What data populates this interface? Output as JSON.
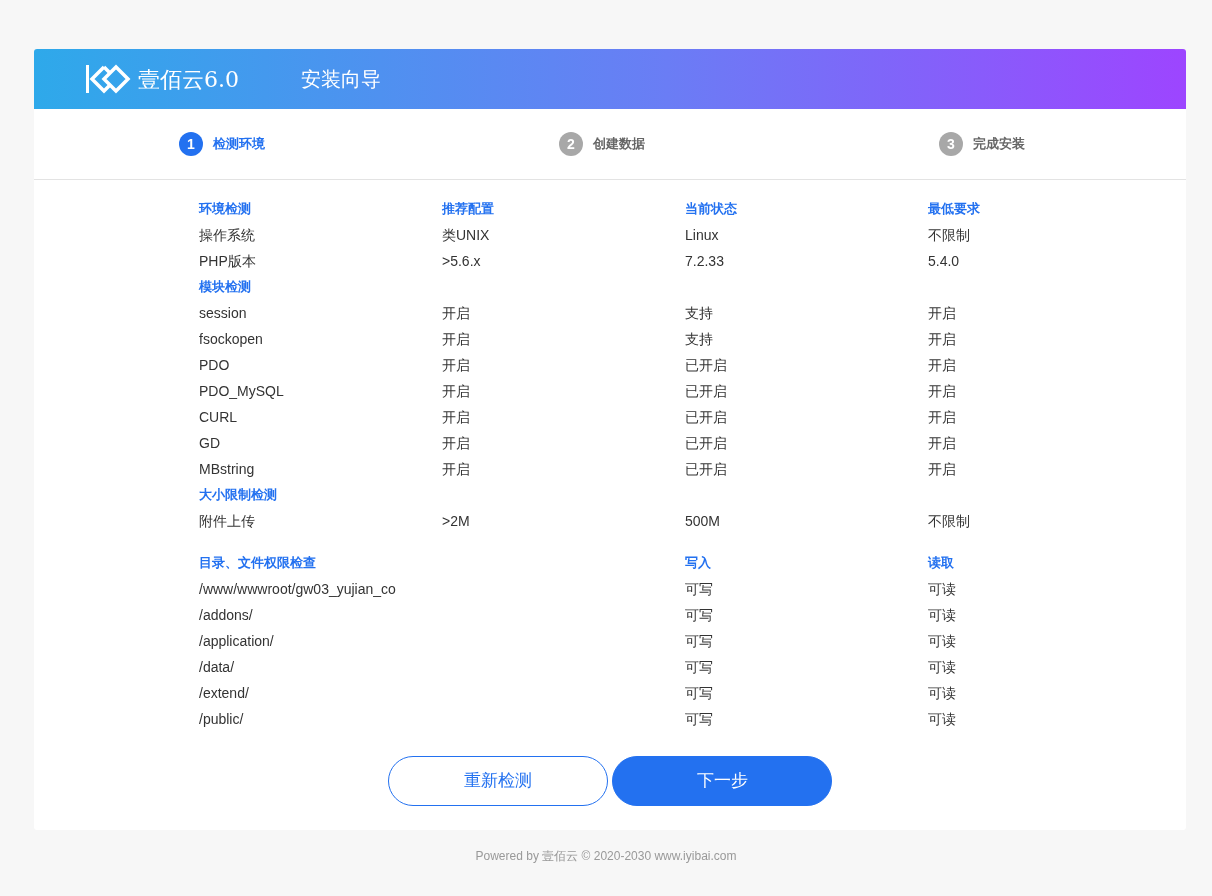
{
  "header": {
    "brand": "壹佰云6.0",
    "title": "安装向导"
  },
  "steps": [
    {
      "number": "1",
      "label": "检测环境",
      "selected": true
    },
    {
      "number": "2",
      "label": "创建数据",
      "selected": false
    },
    {
      "number": "3",
      "label": "完成安装",
      "selected": false
    }
  ],
  "environment": {
    "groups": [
      {
        "title": "环境检测",
        "columns": [
          "推荐配置",
          "当前状态",
          "最低要求"
        ],
        "rows": [
          {
            "name": "操作系统",
            "cells": [
              "类UNIX",
              "Linux",
              "不限制"
            ]
          },
          {
            "name": "PHP版本",
            "cells": [
              ">5.6.x",
              "7.2.33",
              "5.4.0"
            ]
          }
        ]
      },
      {
        "title": "模块检测",
        "rows": [
          {
            "name": "session",
            "cells": [
              "开启",
              "支持",
              "开启"
            ]
          },
          {
            "name": "fsockopen",
            "cells": [
              "开启",
              "支持",
              "开启"
            ]
          },
          {
            "name": "PDO",
            "cells": [
              "开启",
              "已开启",
              "开启"
            ]
          },
          {
            "name": "PDO_MySQL",
            "cells": [
              "开启",
              "已开启",
              "开启"
            ]
          },
          {
            "name": "CURL",
            "cells": [
              "开启",
              "已开启",
              "开启"
            ]
          },
          {
            "name": "GD",
            "cells": [
              "开启",
              "已开启",
              "开启"
            ]
          },
          {
            "name": "MBstring",
            "cells": [
              "开启",
              "已开启",
              "开启"
            ]
          }
        ]
      },
      {
        "title": "大小限制检测",
        "rows": [
          {
            "name": "附件上传",
            "cells": [
              ">2M",
              "500M",
              "不限制"
            ]
          }
        ]
      }
    ]
  },
  "permissions": {
    "columns": {
      "path": "目录、文件权限检查",
      "write": "写入",
      "read": "读取"
    },
    "rows": [
      {
        "path": "/www/wwwroot/gw03_yujian_co",
        "write": "可写",
        "read": "可读"
      },
      {
        "path": "/addons/",
        "write": "可写",
        "read": "可读"
      },
      {
        "path": "/application/",
        "write": "可写",
        "read": "可读"
      },
      {
        "path": "/data/",
        "write": "可写",
        "read": "可读"
      },
      {
        "path": "/extend/",
        "write": "可写",
        "read": "可读"
      },
      {
        "path": "/public/",
        "write": "可写",
        "read": "可读"
      }
    ]
  },
  "buttons": {
    "recheck": "重新检测",
    "next": "下一步"
  },
  "footer": "Powered by 壹佰云 © 2020-2030 www.iyibai.com"
}
